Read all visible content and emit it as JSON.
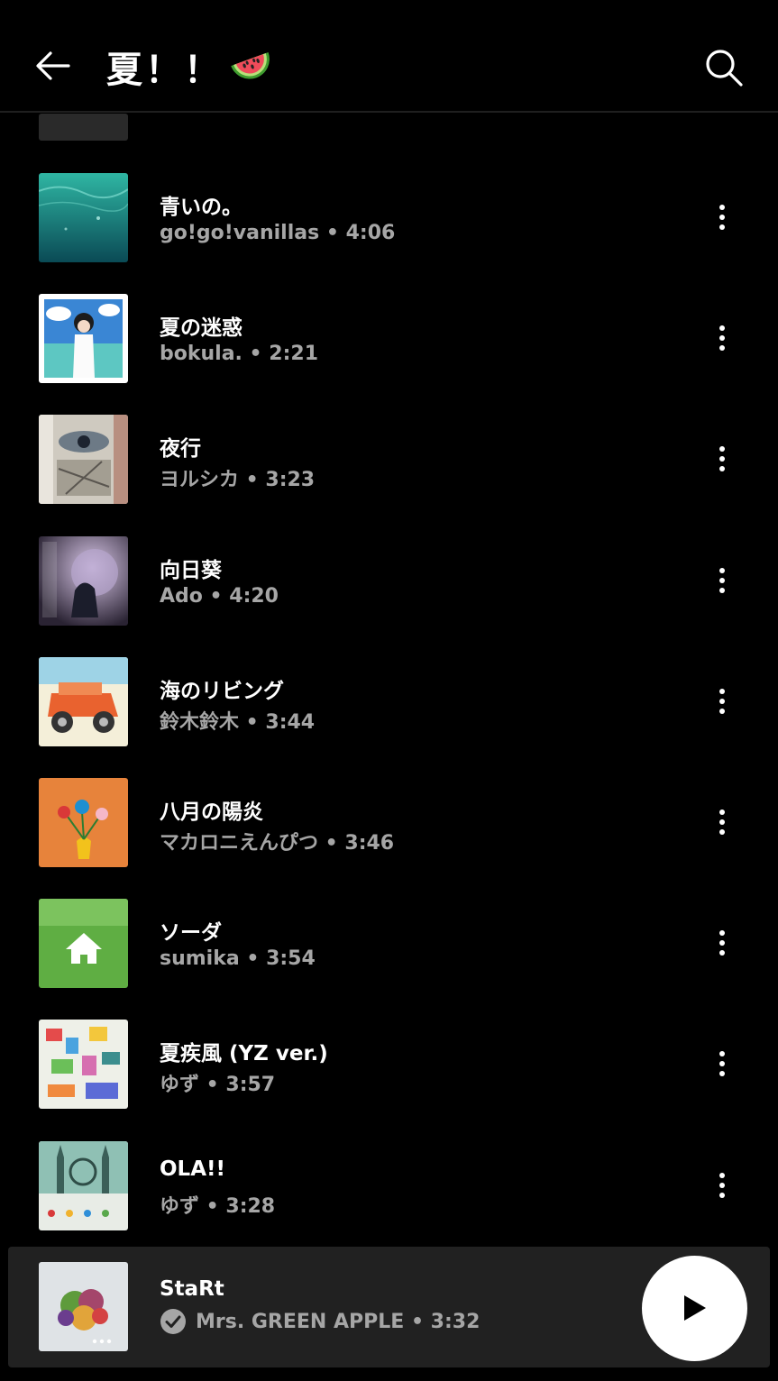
{
  "header": {
    "title": "夏！！",
    "title_emoji_icon": "watermelon-icon",
    "back_icon": "arrow-left-icon",
    "search_icon": "search-icon"
  },
  "tracks": [
    {
      "title": "青いの。",
      "meta": "go!go!vanillas • 4:06",
      "art": "underwater-cover"
    },
    {
      "title": "夏の迷惑",
      "meta": "bokula. • 2:21",
      "art": "girl-beach-cover"
    },
    {
      "title": "夜行",
      "meta": "ヨルシカ • 3:23",
      "art": "collage-eye-cover"
    },
    {
      "title": "向日葵",
      "meta": "Ado • 4:20",
      "art": "zanmu-cover"
    },
    {
      "title": "海のリビング",
      "meta": "鈴木鈴木 • 3:44",
      "art": "orange-jeep-cover"
    },
    {
      "title": "八月の陽炎",
      "meta": "マカロニえんぴつ • 3:46",
      "art": "flowers-vase-cover"
    },
    {
      "title": "ソーダ",
      "meta": "sumika • 3:54",
      "art": "house-grass-cover"
    },
    {
      "title": "夏疾風 (YZ ver.)",
      "meta": "ゆず • 3:57",
      "art": "pixel-city-cover"
    },
    {
      "title": "OLA!!",
      "meta": "ゆず • 3:28",
      "art": "cathedral-cover"
    }
  ],
  "now_playing": {
    "title": "StaRt",
    "meta": "Mrs. GREEN APPLE • 3:32",
    "verified_icon": "check-circle-icon",
    "play_icon": "play-icon",
    "art": "fruit-bouquet-cover"
  },
  "colors": {
    "background": "#000000",
    "secondary_text": "#a6a6a6",
    "player_bar": "#212121"
  }
}
